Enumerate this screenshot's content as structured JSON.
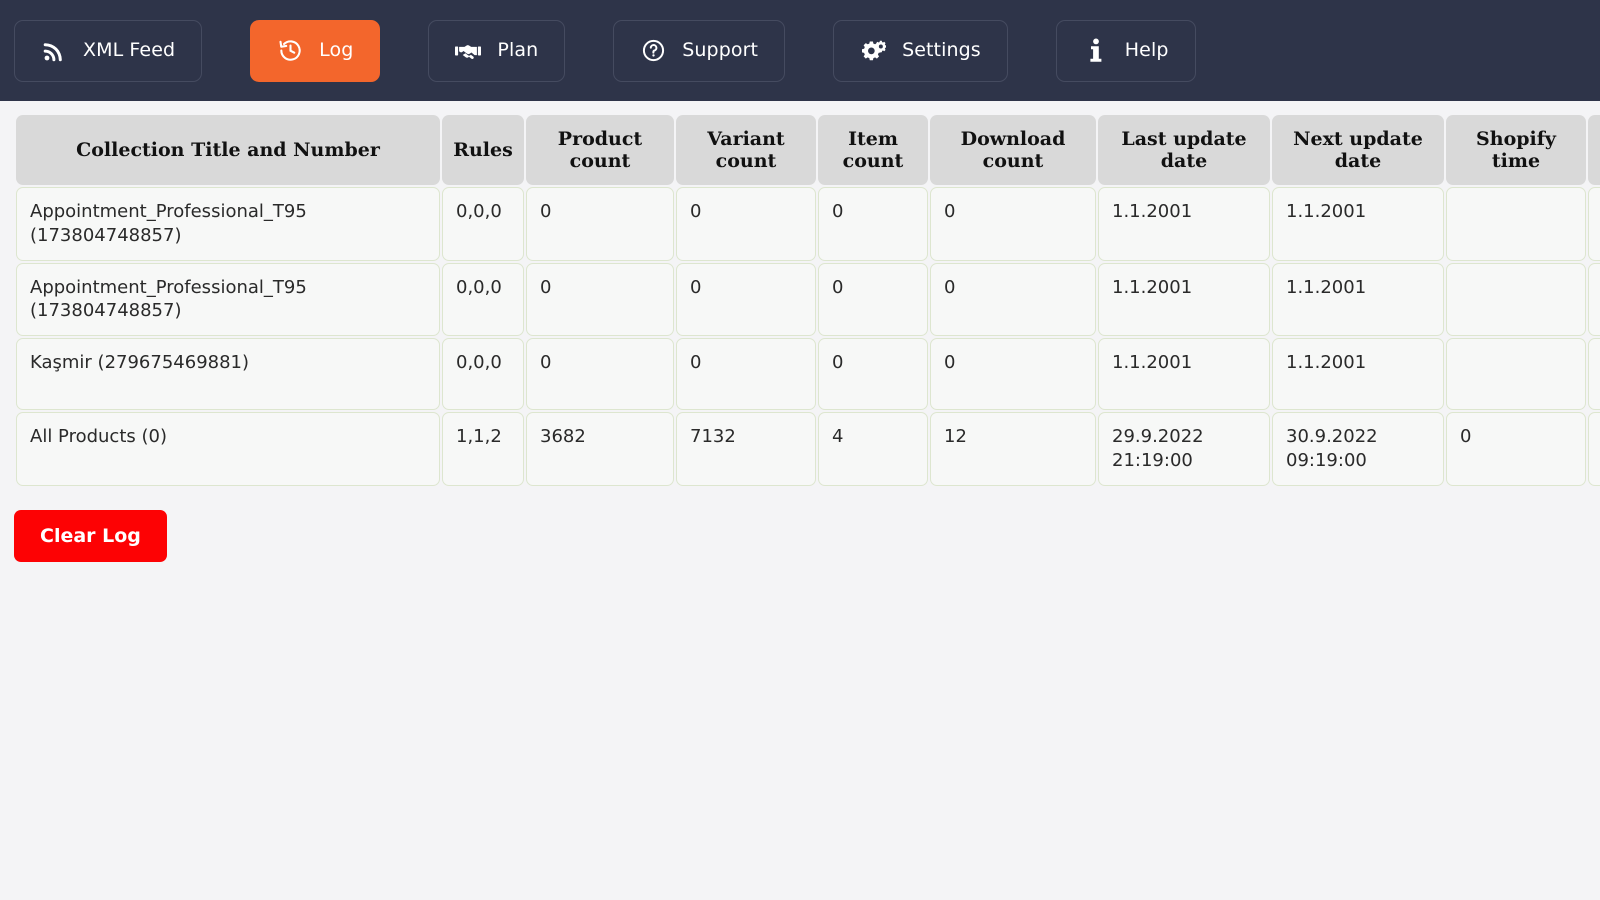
{
  "nav": {
    "items": [
      {
        "label": "XML Feed",
        "icon": "rss-icon",
        "active": false
      },
      {
        "label": "Log",
        "icon": "history-clock-icon",
        "active": true
      },
      {
        "label": "Plan",
        "icon": "handshake-icon",
        "active": false
      },
      {
        "label": "Support",
        "icon": "question-circle-icon",
        "active": false
      },
      {
        "label": "Settings",
        "icon": "gears-icon",
        "active": false
      },
      {
        "label": "Help",
        "icon": "info-icon",
        "active": false
      }
    ],
    "background_color": "#2e3449",
    "active_color": "#f3662c"
  },
  "table": {
    "headers": [
      "Collection Title and Number",
      "Rules",
      "Product count",
      "Variant count",
      "Item count",
      "Download count",
      "Last update date",
      "Next update date",
      "Shopify time",
      ""
    ],
    "rows": [
      {
        "title": "Appointment_Professional_T95 (173804748857)",
        "rules": "0,0,0",
        "product_count": "0",
        "variant_count": "0",
        "item_count": "0",
        "download_count": "0",
        "last_update_date": "1.1.2001",
        "next_update_date": "1.1.2001",
        "shopify_time": "",
        "extra": ""
      },
      {
        "title": "Appointment_Professional_T95 (173804748857)",
        "rules": "0,0,0",
        "product_count": "0",
        "variant_count": "0",
        "item_count": "0",
        "download_count": "0",
        "last_update_date": "1.1.2001",
        "next_update_date": "1.1.2001",
        "shopify_time": "",
        "extra": ""
      },
      {
        "title": "Kaşmir (279675469881)",
        "rules": "0,0,0",
        "product_count": "0",
        "variant_count": "0",
        "item_count": "0",
        "download_count": "0",
        "last_update_date": "1.1.2001",
        "next_update_date": "1.1.2001",
        "shopify_time": "",
        "extra": ""
      },
      {
        "title": "All Products (0)",
        "rules": "1,1,2",
        "product_count": "3682",
        "variant_count": "7132",
        "item_count": "4",
        "download_count": "12",
        "last_update_date": "29.9.2022 21:19:00",
        "next_update_date": "30.9.2022 09:19:00",
        "shopify_time": "0",
        "extra": ""
      }
    ]
  },
  "actions": {
    "clear_log_label": "Clear Log",
    "clear_log_color": "#fd0204"
  }
}
